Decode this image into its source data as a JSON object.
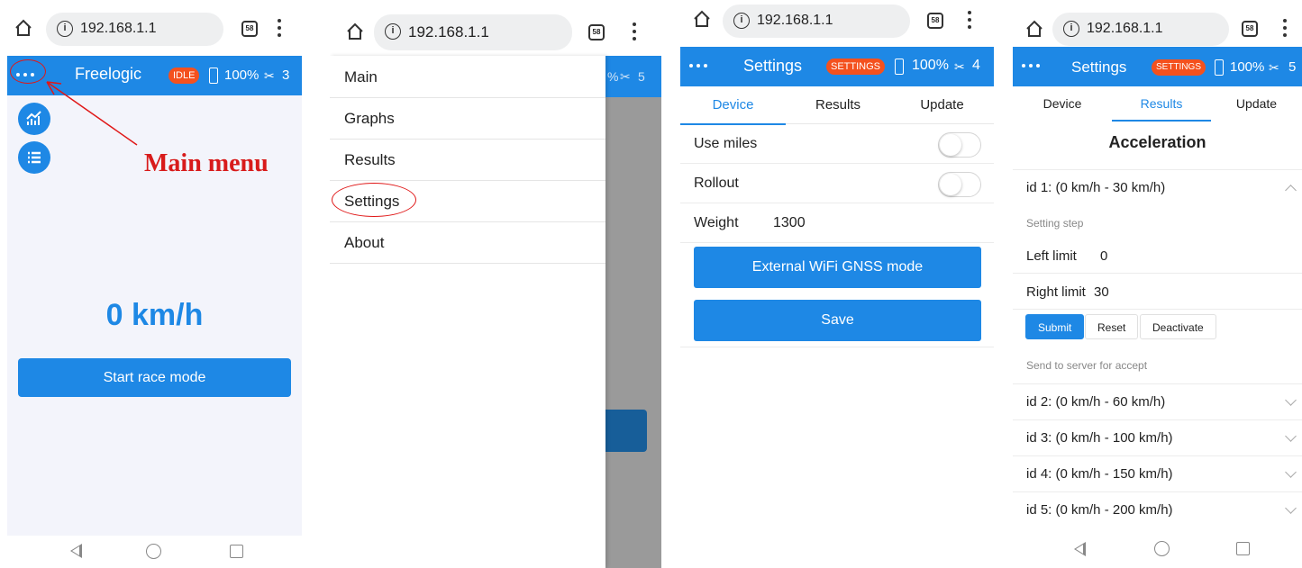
{
  "browser": {
    "url": "192.168.1.1",
    "tab_count": "58"
  },
  "screen1": {
    "title": "Freelogic",
    "badge": "IDLE",
    "battery": "100%",
    "satellites": "3",
    "speed": "0 km/h",
    "race_button": "Start race mode",
    "annotation": "Main menu"
  },
  "screen2": {
    "menu": [
      {
        "label": "Main"
      },
      {
        "label": "Graphs"
      },
      {
        "label": "Results"
      },
      {
        "label": "Settings"
      },
      {
        "label": "About"
      }
    ],
    "peek_battery": "%",
    "peek_satellites": "5"
  },
  "screen3": {
    "title": "Settings",
    "badge": "SETTINGS",
    "battery": "100%",
    "satellites": "4",
    "tabs": [
      "Device",
      "Results",
      "Update"
    ],
    "active_tab": "Device",
    "use_miles_label": "Use miles",
    "rollout_label": "Rollout",
    "weight_label": "Weight",
    "weight_value": "1300",
    "gnss_button": "External WiFi GNSS mode",
    "save_button": "Save"
  },
  "screen4": {
    "title": "Settings",
    "badge": "SETTINGS",
    "battery": "100%",
    "satellites": "5",
    "tabs": [
      "Device",
      "Results",
      "Update"
    ],
    "active_tab": "Results",
    "section_title": "Acceleration",
    "expanded_item": "id 1: (0 km/h - 30 km/h)",
    "setting_step": "Setting step",
    "left_limit_label": "Left limit",
    "left_limit_value": "0",
    "right_limit_label": "Right limit",
    "right_limit_value": "30",
    "submit": "Submit",
    "reset": "Reset",
    "deactivate": "Deactivate",
    "send_note": "Send to server for accept",
    "items": [
      "id 2: (0 km/h - 60 km/h)",
      "id 3: (0 km/h - 100 km/h)",
      "id 4: (0 km/h - 150 km/h)",
      "id 5: (0 km/h - 200 km/h)"
    ]
  },
  "colors": {
    "primary": "#1e88e5",
    "badge": "#f4511e",
    "annotation": "#d81b1b",
    "overlay": "#9a9a9a"
  }
}
